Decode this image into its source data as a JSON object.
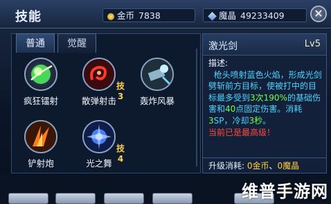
{
  "header": {
    "title": "技能",
    "gold_label": "金币",
    "gold_value": "7838",
    "crystal_label": "魔晶",
    "crystal_value": "49233409",
    "close_glyph": "✕"
  },
  "tabs": [
    {
      "label": "普通",
      "active": true
    },
    {
      "label": "觉醒",
      "active": false
    }
  ],
  "skills": [
    {
      "name": "疯狂镭射",
      "icon": "green-orb-icon",
      "badge": ""
    },
    {
      "name": "散弹射击",
      "icon": "red-swirl-icon",
      "badge": "技3"
    },
    {
      "name": "轰炸风暴",
      "icon": "cannon-blast-icon",
      "badge": ""
    },
    {
      "name": "铲射炮",
      "icon": "fire-blades-icon",
      "badge": ""
    },
    {
      "name": "光之舞",
      "icon": "blue-burst-icon",
      "badge": "技4"
    }
  ],
  "detail": {
    "skill_name": "激光剑",
    "level": "Lv5",
    "desc_label": "描述:",
    "desc_part1": "枪头喷射蓝色火焰，形成光剑劈斩前方目标，使被打中的目标最多受到",
    "hits": "3次",
    "percent": "190%",
    "desc_part2": "的基础伤害和",
    "fixed_damage": "40",
    "desc_part3": "点固定伤害。消耗",
    "sp_cost": "3",
    "sp_unit": "SP",
    "cooldown_prefix": "，冷却",
    "cooldown": "3秒",
    "cooldown_suffix": "。",
    "max_level_note": "当前已是最高级！",
    "upgrade_label": "升级消耗:",
    "upgrade_gold": "0金币",
    "sep": "、",
    "upgrade_crystal": "0魔晶"
  },
  "watermark": "维普手游网",
  "colors": {
    "accent_blue": "#4fd3ff",
    "highlight_green": "#6dff55",
    "warning_red": "#ff4a3c",
    "gold": "#ffcf3a"
  }
}
